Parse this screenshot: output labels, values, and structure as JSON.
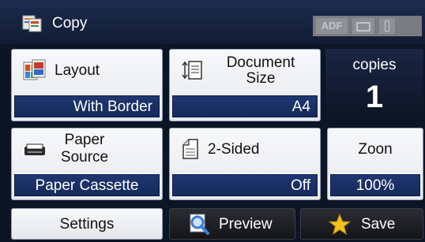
{
  "header": {
    "title": "Copy",
    "status": {
      "adf": "ADF"
    }
  },
  "panels": {
    "layout": {
      "label": "Layout",
      "value": "With Border"
    },
    "document_size": {
      "label_line1": "Document",
      "label_line2": "Size",
      "value": "A4"
    },
    "copies": {
      "label": "copies",
      "value": "1"
    },
    "paper_source": {
      "label_line1": "Paper",
      "label_line2": "Source",
      "value": "Paper Cassette"
    },
    "two_sided": {
      "label": "2-Sided",
      "value": "Off"
    },
    "zoom": {
      "label": "Zoon",
      "value": "100%"
    }
  },
  "buttons": {
    "settings": "Settings",
    "preview": "Preview",
    "save": "Save"
  },
  "colors": {
    "value_bar": "#152a5c",
    "header": "#16233f",
    "save_star": "#f2c21b",
    "preview_icon": "#3b7fd6"
  },
  "icons": [
    "copy-icon",
    "layout-icon",
    "document-size-icon",
    "paper-source-icon",
    "two-sided-icon",
    "preview-icon",
    "star-icon"
  ]
}
